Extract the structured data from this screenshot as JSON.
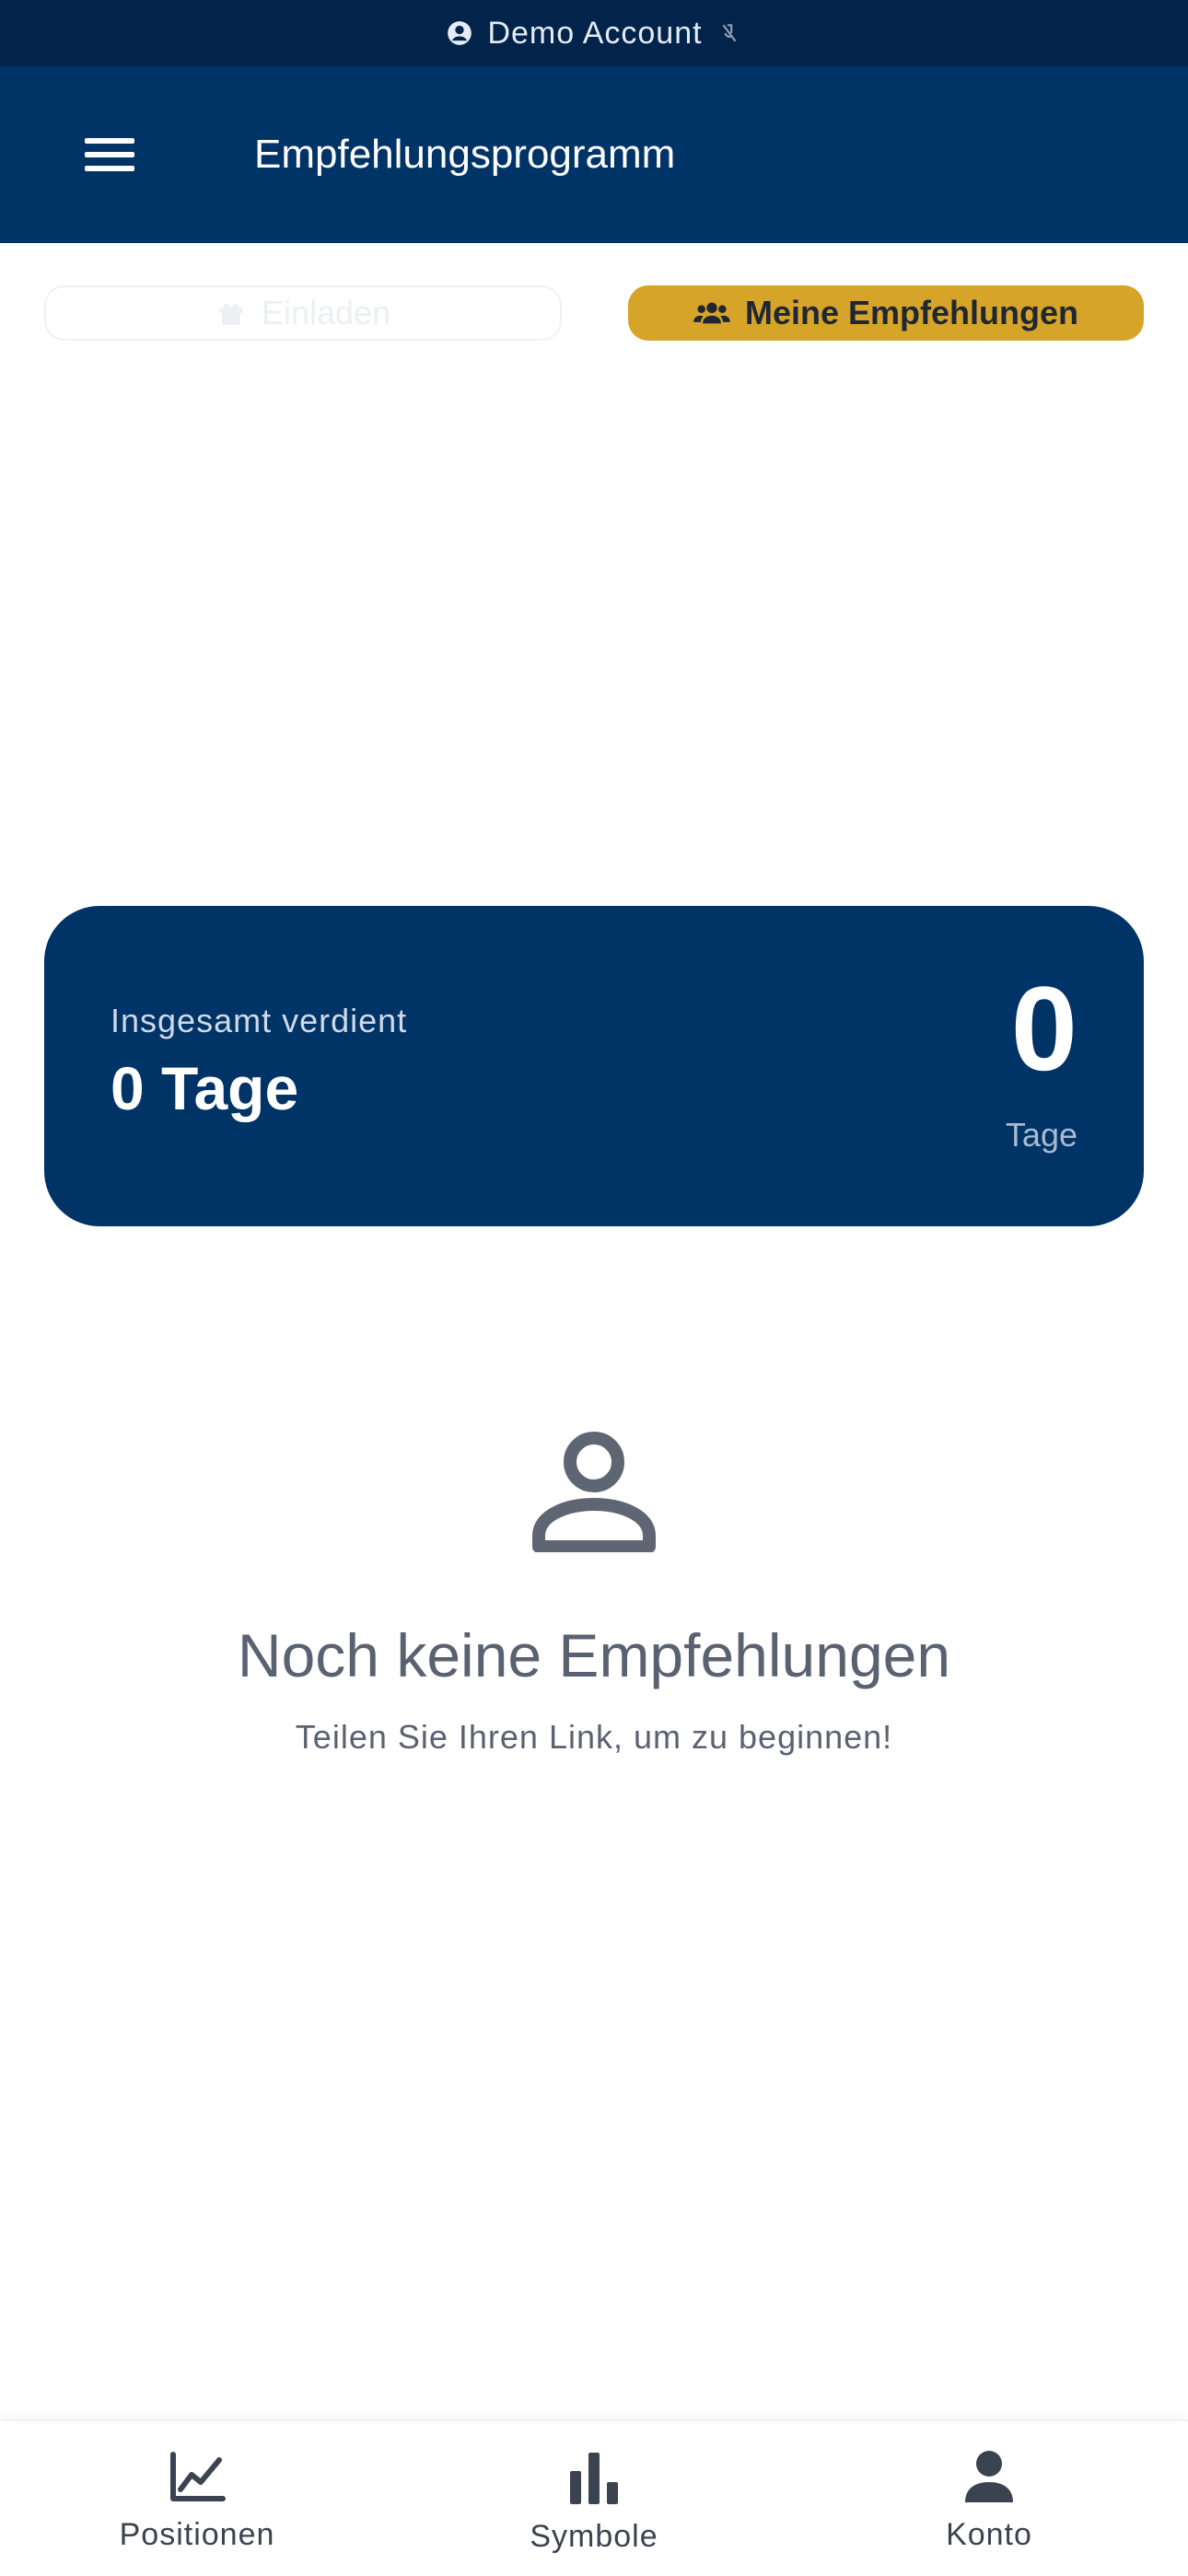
{
  "status_bar": {
    "account_label": "Demo Account"
  },
  "header": {
    "title": "Empfehlungsprogramm"
  },
  "tabs": [
    {
      "label": "Einladen",
      "icon": "gift-icon",
      "active": false
    },
    {
      "label": "Meine Empfehlungen",
      "icon": "users-icon",
      "active": true
    }
  ],
  "earnings": {
    "label": "Insgesamt verdient",
    "value": "0 Tage",
    "big_number": "0",
    "unit": "Tage"
  },
  "empty_state": {
    "icon": "person-icon",
    "title": "Noch keine Empfehlungen",
    "subtitle": "Teilen Sie Ihren Link, um zu beginnen!"
  },
  "bottom_nav": [
    {
      "label": "Positionen",
      "icon": "line-chart-icon"
    },
    {
      "label": "Symbole",
      "icon": "bar-chart-icon"
    },
    {
      "label": "Konto",
      "icon": "user-icon"
    }
  ],
  "colors": {
    "header_bg": "#003366",
    "status_bg": "#02234a",
    "accent": "#d6a428",
    "muted_text": "#5a6271"
  }
}
